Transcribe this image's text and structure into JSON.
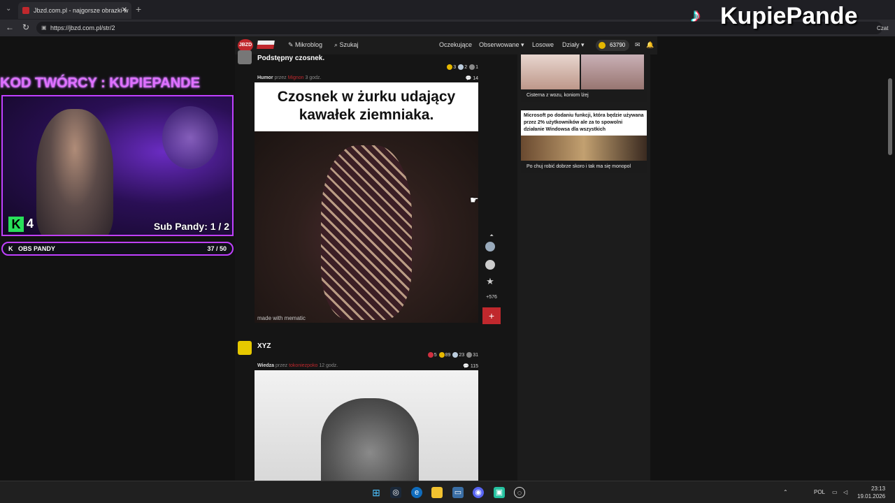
{
  "browser": {
    "tab_title": "Jbzd.com.pl - najgorsze obrazki w",
    "url": "https://jbzd.com.pl/str/2",
    "chat_label": "Czat"
  },
  "site": {
    "logo_text": "JBZD",
    "nav": {
      "mikroblog": "Mikroblog",
      "szukaj": "Szukaj",
      "oczekujace": "Oczekujące",
      "obserwowane": "Obserwowane ▾",
      "losowe": "Losowe",
      "dzialy": "Działy ▾"
    },
    "coins": "63790"
  },
  "posts": [
    {
      "title": "Podstępny czosnek.",
      "votes": [
        "3",
        "2",
        "1"
      ],
      "category": "Humor",
      "by_label": "przez",
      "author": "Mignon",
      "time": "3 godz.",
      "comments": "14",
      "caption": "Czosnek w żurku udający kawałek ziemniaka.",
      "watermark": "made with mematic",
      "score": "+576"
    },
    {
      "title": "XYZ",
      "votes": [
        "5",
        "89",
        "23",
        "31"
      ],
      "category": "Wiedza",
      "by_label": "przez",
      "author": "tokoniezpoko",
      "time": "12 godz.",
      "comments": "115"
    }
  ],
  "sidebar": {
    "cards": [
      {
        "label": "Cisterna z wozu, koniom lżej"
      },
      {
        "top_text": "Microsoft po dodaniu funkcji, która będzie używana przez 2% użytkowników ale za to spowolni działanie Windowsa dla wszystkich",
        "label": "Po chuj robić dobrze skoro i tak ma się monopol"
      }
    ]
  },
  "stream": {
    "kod_text": "KOD TWÓRCY : KUPIEPANDE",
    "kick_count": "4",
    "sub_goal": "Sub Pandy: 1 / 2",
    "obs_label": "OBS PANDY",
    "obs_count": "37 / 50",
    "brand_name": "KupiePande"
  },
  "taskbar": {
    "lang": "POL",
    "time": "23:13",
    "date": "19.01.2026"
  },
  "colors": {
    "accent": "#c0282d",
    "stream_accent": "#c040ff",
    "kick_green": "#28e05a"
  }
}
